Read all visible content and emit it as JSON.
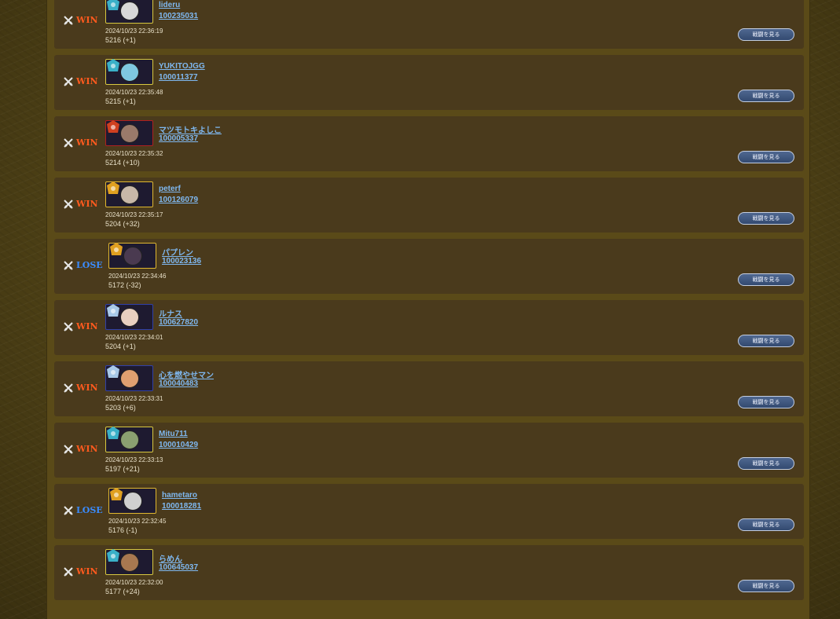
{
  "battles": [
    {
      "result": "WIN",
      "frame": "yellow",
      "badge": "teal",
      "face": "#d8d8d8",
      "name": "lideru",
      "id": "100235031",
      "time": "2024/10/23 22:36:19",
      "rating": "5216 (+1)",
      "button": "戦闘を見る"
    },
    {
      "result": "WIN",
      "frame": "yellow",
      "badge": "teal",
      "face": "#7fc8e0",
      "name": "YUKITOJGG",
      "id": "100011377",
      "time": "2024/10/23 22:35:48",
      "rating": "5215 (+1)",
      "button": "戦闘を見る"
    },
    {
      "result": "WIN",
      "frame": "red",
      "badge": "red",
      "face": "#9a7a6a",
      "name": "マツモトキよしこ",
      "id": "100005337",
      "time": "2024/10/23 22:35:32",
      "rating": "5214 (+10)",
      "button": "戦闘を見る"
    },
    {
      "result": "WIN",
      "frame": "gold",
      "badge": "gold",
      "face": "#c8b8a8",
      "name": "peterf",
      "id": "100126079",
      "time": "2024/10/23 22:35:17",
      "rating": "5204 (+32)",
      "button": "戦闘を見る"
    },
    {
      "result": "LOSE",
      "frame": "gold",
      "badge": "gold",
      "face": "#4a3a50",
      "name": "パプレン",
      "id": "100023136",
      "time": "2024/10/23 22:34:46",
      "rating": "5172 (-32)",
      "button": "戦闘を見る"
    },
    {
      "result": "WIN",
      "frame": "blue",
      "badge": "light",
      "face": "#e8d0c0",
      "name": "ルナス",
      "id": "100627820",
      "time": "2024/10/23 22:34:01",
      "rating": "5204 (+1)",
      "button": "戦闘を見る"
    },
    {
      "result": "WIN",
      "frame": "blue",
      "badge": "light",
      "face": "#e0a070",
      "name": "心を燃やせマン",
      "id": "100040483",
      "time": "2024/10/23 22:33:31",
      "rating": "5203 (+6)",
      "button": "戦闘を見る"
    },
    {
      "result": "WIN",
      "frame": "yellow",
      "badge": "teal",
      "face": "#8aa070",
      "name": "Mitu711",
      "id": "100010429",
      "time": "2024/10/23 22:33:13",
      "rating": "5197 (+21)",
      "button": "戦闘を見る"
    },
    {
      "result": "LOSE",
      "frame": "gold",
      "badge": "gold",
      "face": "#d0d0d0",
      "name": "hametaro",
      "id": "100018281",
      "time": "2024/10/23 22:32:45",
      "rating": "5176 (-1)",
      "button": "戦闘を見る"
    },
    {
      "result": "WIN",
      "frame": "yellow",
      "badge": "teal",
      "face": "#a87850",
      "name": "らめん",
      "id": "100645037",
      "time": "2024/10/23 22:32:00",
      "rating": "5177 (+24)",
      "button": "戦闘を見る"
    }
  ],
  "colors": {
    "win": "#ff5a1e",
    "lose": "#3a8cff",
    "link": "#7fb8f0",
    "panel": "#4a3a1c"
  },
  "icons": {
    "result": "crossed-swords-icon",
    "badge": "rank-badge-icon"
  }
}
